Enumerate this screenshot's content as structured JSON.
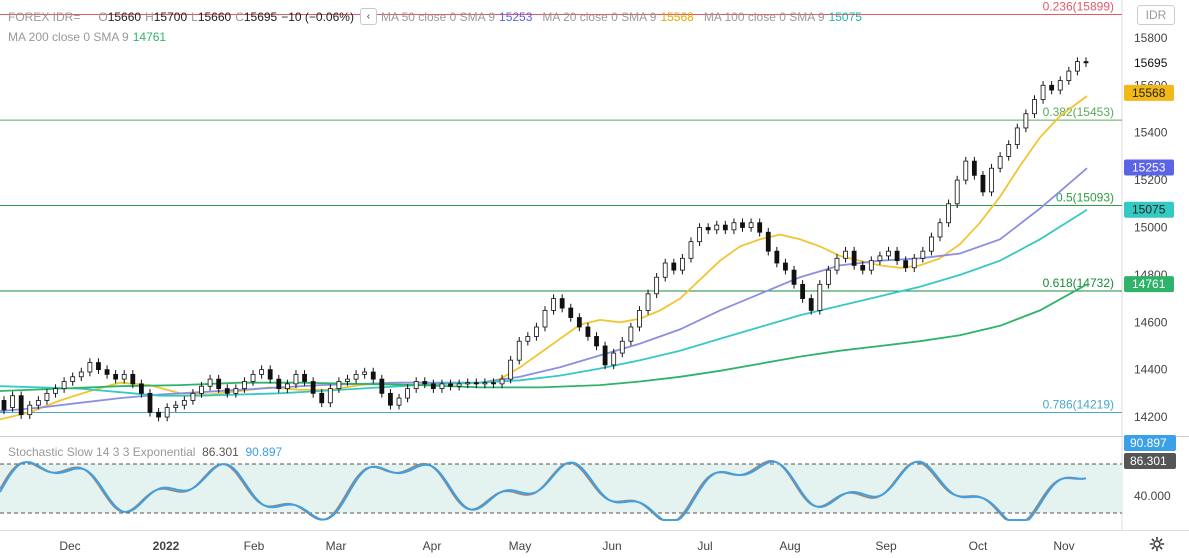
{
  "header": {
    "symbol": "FOREX IDR=",
    "o_label": "O",
    "o_value": "15660",
    "h_label": "H",
    "h_value": "15700",
    "l_label": "L",
    "l_value": "15660",
    "c_label": "C",
    "c_value": "15695",
    "change": "−10 (−0.06%)",
    "ma50_label": "MA 50 close 0 SMA 9",
    "ma50_value": "15253",
    "ma20_label": "MA 20 close 0 SMA 9",
    "ma20_value": "15568",
    "ma100_label": "MA 100 close 0 SMA 9",
    "ma100_value": "15075",
    "ma200_label": "MA 200 close 0 SMA 9",
    "ma200_value": "14761",
    "symbol_box": "IDR"
  },
  "stochastic": {
    "label": "Stochastic Slow 14 3 3 Exponential",
    "k_value": "86.301",
    "d_value": "90.897",
    "axis_label": "40.000",
    "badge_k": "86.301",
    "badge_d": "90.897"
  },
  "chart_data": {
    "type": "candlestick",
    "ylim": [
      14120,
      15960
    ],
    "y_ticks": [
      "14200",
      "14400",
      "14600",
      "14800",
      "15000",
      "15200",
      "15400",
      "15600",
      "15800"
    ],
    "x_ticks": [
      "Dec",
      "2022",
      "Feb",
      "Mar",
      "Apr",
      "May",
      "Jun",
      "Jul",
      "Aug",
      "Sep",
      "Oct",
      "Nov"
    ],
    "last_price": "15695",
    "fib_levels": [
      {
        "label": "0.236(15899)",
        "value": 15899,
        "color": "#e05a6a"
      },
      {
        "label": "0.382(15453)",
        "value": 15453,
        "color": "#5aaa5a"
      },
      {
        "label": "0.5(15093)",
        "value": 15093,
        "color": "#2f9e46"
      },
      {
        "label": "0.618(14732)",
        "value": 14732,
        "color": "#1a8a3a"
      },
      {
        "label": "0.786(14219)",
        "value": 14219,
        "color": "#4aa8c8"
      }
    ],
    "badges": [
      {
        "text": "15568",
        "value": 15568,
        "bg": "#f2b815",
        "fg": "#222222"
      },
      {
        "text": "15253",
        "value": 15253,
        "bg": "#5b63e6",
        "fg": "#ffffff"
      },
      {
        "text": "15075",
        "value": 15075,
        "bg": "#35c9c4",
        "fg": "#222222"
      },
      {
        "text": "14761",
        "value": 14761,
        "bg": "#2fb36a",
        "fg": "#ffffff"
      }
    ],
    "series": [
      {
        "name": "MA 20",
        "color": "#f2c530",
        "points": [
          [
            0,
            14190
          ],
          [
            30,
            14220
          ],
          [
            60,
            14270
          ],
          [
            90,
            14310
          ],
          [
            120,
            14345
          ],
          [
            150,
            14335
          ],
          [
            180,
            14300
          ],
          [
            210,
            14295
          ],
          [
            240,
            14310
          ],
          [
            270,
            14325
          ],
          [
            300,
            14315
          ],
          [
            330,
            14315
          ],
          [
            360,
            14335
          ],
          [
            390,
            14345
          ],
          [
            420,
            14345
          ],
          [
            450,
            14340
          ],
          [
            480,
            14345
          ],
          [
            500,
            14360
          ],
          [
            520,
            14410
          ],
          [
            540,
            14470
          ],
          [
            560,
            14530
          ],
          [
            580,
            14590
          ],
          [
            600,
            14610
          ],
          [
            620,
            14600
          ],
          [
            640,
            14615
          ],
          [
            660,
            14650
          ],
          [
            680,
            14700
          ],
          [
            700,
            14780
          ],
          [
            720,
            14860
          ],
          [
            740,
            14920
          ],
          [
            760,
            14950
          ],
          [
            780,
            14970
          ],
          [
            800,
            14950
          ],
          [
            820,
            14920
          ],
          [
            840,
            14880
          ],
          [
            860,
            14860
          ],
          [
            880,
            14840
          ],
          [
            900,
            14830
          ],
          [
            920,
            14840
          ],
          [
            940,
            14870
          ],
          [
            960,
            14930
          ],
          [
            980,
            15020
          ],
          [
            1000,
            15130
          ],
          [
            1020,
            15260
          ],
          [
            1040,
            15380
          ],
          [
            1060,
            15470
          ],
          [
            1087,
            15555
          ]
        ]
      },
      {
        "name": "MA 50",
        "color": "#8b8fe0",
        "points": [
          [
            0,
            14225
          ],
          [
            40,
            14240
          ],
          [
            80,
            14260
          ],
          [
            120,
            14280
          ],
          [
            160,
            14295
          ],
          [
            200,
            14305
          ],
          [
            240,
            14315
          ],
          [
            280,
            14325
          ],
          [
            320,
            14335
          ],
          [
            360,
            14340
          ],
          [
            400,
            14345
          ],
          [
            440,
            14345
          ],
          [
            480,
            14345
          ],
          [
            520,
            14370
          ],
          [
            560,
            14410
          ],
          [
            600,
            14460
          ],
          [
            640,
            14510
          ],
          [
            680,
            14570
          ],
          [
            720,
            14650
          ],
          [
            760,
            14720
          ],
          [
            800,
            14790
          ],
          [
            840,
            14840
          ],
          [
            880,
            14860
          ],
          [
            920,
            14870
          ],
          [
            960,
            14890
          ],
          [
            1000,
            14950
          ],
          [
            1040,
            15080
          ],
          [
            1087,
            15250
          ]
        ]
      },
      {
        "name": "MA 100",
        "color": "#35c9c4",
        "points": [
          [
            0,
            14330
          ],
          [
            40,
            14325
          ],
          [
            80,
            14320
          ],
          [
            120,
            14305
          ],
          [
            160,
            14290
          ],
          [
            200,
            14290
          ],
          [
            240,
            14295
          ],
          [
            280,
            14300
          ],
          [
            320,
            14310
          ],
          [
            360,
            14320
          ],
          [
            400,
            14330
          ],
          [
            440,
            14340
          ],
          [
            480,
            14345
          ],
          [
            520,
            14355
          ],
          [
            560,
            14375
          ],
          [
            600,
            14405
          ],
          [
            640,
            14440
          ],
          [
            680,
            14480
          ],
          [
            720,
            14530
          ],
          [
            760,
            14580
          ],
          [
            800,
            14630
          ],
          [
            840,
            14670
          ],
          [
            880,
            14710
          ],
          [
            920,
            14750
          ],
          [
            960,
            14800
          ],
          [
            1000,
            14860
          ],
          [
            1040,
            14950
          ],
          [
            1087,
            15075
          ]
        ]
      },
      {
        "name": "MA 200",
        "color": "#2fb36a",
        "points": [
          [
            0,
            14310
          ],
          [
            60,
            14320
          ],
          [
            120,
            14330
          ],
          [
            180,
            14335
          ],
          [
            240,
            14345
          ],
          [
            300,
            14345
          ],
          [
            360,
            14340
          ],
          [
            420,
            14335
          ],
          [
            480,
            14325
          ],
          [
            540,
            14325
          ],
          [
            600,
            14335
          ],
          [
            640,
            14350
          ],
          [
            680,
            14370
          ],
          [
            720,
            14395
          ],
          [
            760,
            14425
          ],
          [
            800,
            14455
          ],
          [
            840,
            14480
          ],
          [
            880,
            14500
          ],
          [
            920,
            14520
          ],
          [
            960,
            14545
          ],
          [
            1000,
            14585
          ],
          [
            1040,
            14650
          ],
          [
            1087,
            14760
          ]
        ]
      }
    ],
    "candles": [
      [
        14270,
        14230
      ],
      [
        14240,
        14290
      ],
      [
        14290,
        14210
      ],
      [
        14210,
        14250
      ],
      [
        14250,
        14270
      ],
      [
        14270,
        14300
      ],
      [
        14300,
        14320
      ],
      [
        14320,
        14350
      ],
      [
        14350,
        14370
      ],
      [
        14370,
        14390
      ],
      [
        14390,
        14430
      ],
      [
        14430,
        14400
      ],
      [
        14400,
        14380
      ],
      [
        14380,
        14360
      ],
      [
        14360,
        14380
      ],
      [
        14380,
        14340
      ],
      [
        14340,
        14300
      ],
      [
        14300,
        14220
      ],
      [
        14220,
        14200
      ],
      [
        14200,
        14240
      ],
      [
        14240,
        14250
      ],
      [
        14250,
        14270
      ],
      [
        14270,
        14300
      ],
      [
        14300,
        14330
      ],
      [
        14330,
        14360
      ],
      [
        14360,
        14320
      ],
      [
        14320,
        14300
      ],
      [
        14300,
        14320
      ],
      [
        14320,
        14350
      ],
      [
        14350,
        14380
      ],
      [
        14380,
        14400
      ],
      [
        14400,
        14360
      ],
      [
        14360,
        14320
      ],
      [
        14320,
        14340
      ],
      [
        14340,
        14380
      ],
      [
        14380,
        14350
      ],
      [
        14350,
        14300
      ],
      [
        14300,
        14260
      ],
      [
        14260,
        14320
      ],
      [
        14320,
        14350
      ],
      [
        14350,
        14360
      ],
      [
        14360,
        14380
      ],
      [
        14380,
        14390
      ],
      [
        14390,
        14360
      ],
      [
        14360,
        14300
      ],
      [
        14300,
        14250
      ],
      [
        14250,
        14280
      ],
      [
        14280,
        14320
      ],
      [
        14320,
        14350
      ],
      [
        14350,
        14340
      ],
      [
        14340,
        14320
      ],
      [
        14320,
        14340
      ],
      [
        14340,
        14330
      ],
      [
        14330,
        14340
      ],
      [
        14340,
        14345
      ],
      [
        14345,
        14340
      ],
      [
        14340,
        14345
      ],
      [
        14345,
        14340
      ],
      [
        14340,
        14360
      ],
      [
        14360,
        14440
      ],
      [
        14440,
        14520
      ],
      [
        14520,
        14540
      ],
      [
        14540,
        14580
      ],
      [
        14580,
        14650
      ],
      [
        14650,
        14700
      ],
      [
        14700,
        14660
      ],
      [
        14660,
        14620
      ],
      [
        14620,
        14580
      ],
      [
        14580,
        14540
      ],
      [
        14540,
        14500
      ],
      [
        14500,
        14420
      ],
      [
        14420,
        14470
      ],
      [
        14470,
        14520
      ],
      [
        14520,
        14580
      ],
      [
        14580,
        14650
      ],
      [
        14650,
        14720
      ],
      [
        14720,
        14790
      ],
      [
        14790,
        14850
      ],
      [
        14850,
        14820
      ],
      [
        14820,
        14870
      ],
      [
        14870,
        14940
      ],
      [
        14940,
        15000
      ],
      [
        15000,
        14990
      ],
      [
        14990,
        15010
      ],
      [
        15010,
        14990
      ],
      [
        14990,
        15020
      ],
      [
        15020,
        15000
      ],
      [
        15000,
        15020
      ],
      [
        15020,
        14980
      ],
      [
        14980,
        14900
      ],
      [
        14900,
        14850
      ],
      [
        14850,
        14820
      ],
      [
        14820,
        14760
      ],
      [
        14760,
        14700
      ],
      [
        14700,
        14650
      ],
      [
        14650,
        14760
      ],
      [
        14760,
        14820
      ],
      [
        14820,
        14870
      ],
      [
        14870,
        14900
      ],
      [
        14900,
        14840
      ],
      [
        14840,
        14820
      ],
      [
        14820,
        14860
      ],
      [
        14860,
        14880
      ],
      [
        14880,
        14900
      ],
      [
        14900,
        14860
      ],
      [
        14860,
        14830
      ],
      [
        14830,
        14870
      ],
      [
        14870,
        14900
      ],
      [
        14900,
        14960
      ],
      [
        14960,
        15020
      ],
      [
        15020,
        15100
      ],
      [
        15100,
        15200
      ],
      [
        15200,
        15280
      ],
      [
        15280,
        15220
      ],
      [
        15220,
        15150
      ],
      [
        15150,
        15250
      ],
      [
        15250,
        15300
      ],
      [
        15300,
        15350
      ],
      [
        15350,
        15420
      ],
      [
        15420,
        15480
      ],
      [
        15480,
        15540
      ],
      [
        15540,
        15600
      ],
      [
        15600,
        15580
      ],
      [
        15580,
        15620
      ],
      [
        15620,
        15660
      ],
      [
        15660,
        15700
      ],
      [
        15700,
        15695
      ]
    ]
  }
}
